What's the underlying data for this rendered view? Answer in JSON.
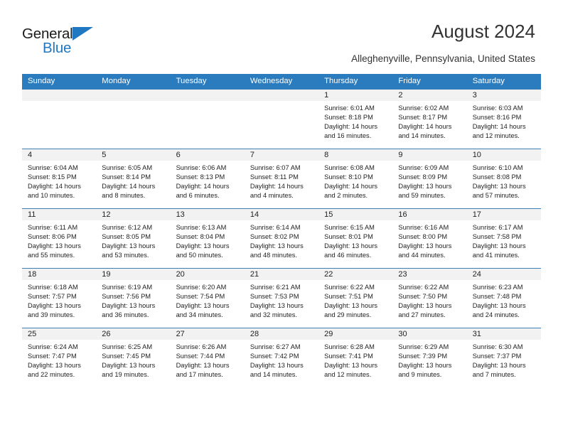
{
  "brand": {
    "name_part1": "General",
    "name_part2": "Blue",
    "triangle_icon": "triangle-icon",
    "colors": {
      "blue": "#1f78c1",
      "black": "#1b1b1b"
    }
  },
  "header": {
    "title": "August 2024",
    "subtitle": "Alleghenyville, Pennsylvania, United States"
  },
  "calendar": {
    "header_bg": "#2b7cbf",
    "weekdays": [
      "Sunday",
      "Monday",
      "Tuesday",
      "Wednesday",
      "Thursday",
      "Friday",
      "Saturday"
    ],
    "weeks": [
      [
        {
          "day": "",
          "lines": []
        },
        {
          "day": "",
          "lines": []
        },
        {
          "day": "",
          "lines": []
        },
        {
          "day": "",
          "lines": []
        },
        {
          "day": "1",
          "lines": [
            "Sunrise: 6:01 AM",
            "Sunset: 8:18 PM",
            "Daylight: 14 hours",
            "and 16 minutes."
          ]
        },
        {
          "day": "2",
          "lines": [
            "Sunrise: 6:02 AM",
            "Sunset: 8:17 PM",
            "Daylight: 14 hours",
            "and 14 minutes."
          ]
        },
        {
          "day": "3",
          "lines": [
            "Sunrise: 6:03 AM",
            "Sunset: 8:16 PM",
            "Daylight: 14 hours",
            "and 12 minutes."
          ]
        }
      ],
      [
        {
          "day": "4",
          "lines": [
            "Sunrise: 6:04 AM",
            "Sunset: 8:15 PM",
            "Daylight: 14 hours",
            "and 10 minutes."
          ]
        },
        {
          "day": "5",
          "lines": [
            "Sunrise: 6:05 AM",
            "Sunset: 8:14 PM",
            "Daylight: 14 hours",
            "and 8 minutes."
          ]
        },
        {
          "day": "6",
          "lines": [
            "Sunrise: 6:06 AM",
            "Sunset: 8:13 PM",
            "Daylight: 14 hours",
            "and 6 minutes."
          ]
        },
        {
          "day": "7",
          "lines": [
            "Sunrise: 6:07 AM",
            "Sunset: 8:11 PM",
            "Daylight: 14 hours",
            "and 4 minutes."
          ]
        },
        {
          "day": "8",
          "lines": [
            "Sunrise: 6:08 AM",
            "Sunset: 8:10 PM",
            "Daylight: 14 hours",
            "and 2 minutes."
          ]
        },
        {
          "day": "9",
          "lines": [
            "Sunrise: 6:09 AM",
            "Sunset: 8:09 PM",
            "Daylight: 13 hours",
            "and 59 minutes."
          ]
        },
        {
          "day": "10",
          "lines": [
            "Sunrise: 6:10 AM",
            "Sunset: 8:08 PM",
            "Daylight: 13 hours",
            "and 57 minutes."
          ]
        }
      ],
      [
        {
          "day": "11",
          "lines": [
            "Sunrise: 6:11 AM",
            "Sunset: 8:06 PM",
            "Daylight: 13 hours",
            "and 55 minutes."
          ]
        },
        {
          "day": "12",
          "lines": [
            "Sunrise: 6:12 AM",
            "Sunset: 8:05 PM",
            "Daylight: 13 hours",
            "and 53 minutes."
          ]
        },
        {
          "day": "13",
          "lines": [
            "Sunrise: 6:13 AM",
            "Sunset: 8:04 PM",
            "Daylight: 13 hours",
            "and 50 minutes."
          ]
        },
        {
          "day": "14",
          "lines": [
            "Sunrise: 6:14 AM",
            "Sunset: 8:02 PM",
            "Daylight: 13 hours",
            "and 48 minutes."
          ]
        },
        {
          "day": "15",
          "lines": [
            "Sunrise: 6:15 AM",
            "Sunset: 8:01 PM",
            "Daylight: 13 hours",
            "and 46 minutes."
          ]
        },
        {
          "day": "16",
          "lines": [
            "Sunrise: 6:16 AM",
            "Sunset: 8:00 PM",
            "Daylight: 13 hours",
            "and 44 minutes."
          ]
        },
        {
          "day": "17",
          "lines": [
            "Sunrise: 6:17 AM",
            "Sunset: 7:58 PM",
            "Daylight: 13 hours",
            "and 41 minutes."
          ]
        }
      ],
      [
        {
          "day": "18",
          "lines": [
            "Sunrise: 6:18 AM",
            "Sunset: 7:57 PM",
            "Daylight: 13 hours",
            "and 39 minutes."
          ]
        },
        {
          "day": "19",
          "lines": [
            "Sunrise: 6:19 AM",
            "Sunset: 7:56 PM",
            "Daylight: 13 hours",
            "and 36 minutes."
          ]
        },
        {
          "day": "20",
          "lines": [
            "Sunrise: 6:20 AM",
            "Sunset: 7:54 PM",
            "Daylight: 13 hours",
            "and 34 minutes."
          ]
        },
        {
          "day": "21",
          "lines": [
            "Sunrise: 6:21 AM",
            "Sunset: 7:53 PM",
            "Daylight: 13 hours",
            "and 32 minutes."
          ]
        },
        {
          "day": "22",
          "lines": [
            "Sunrise: 6:22 AM",
            "Sunset: 7:51 PM",
            "Daylight: 13 hours",
            "and 29 minutes."
          ]
        },
        {
          "day": "23",
          "lines": [
            "Sunrise: 6:22 AM",
            "Sunset: 7:50 PM",
            "Daylight: 13 hours",
            "and 27 minutes."
          ]
        },
        {
          "day": "24",
          "lines": [
            "Sunrise: 6:23 AM",
            "Sunset: 7:48 PM",
            "Daylight: 13 hours",
            "and 24 minutes."
          ]
        }
      ],
      [
        {
          "day": "25",
          "lines": [
            "Sunrise: 6:24 AM",
            "Sunset: 7:47 PM",
            "Daylight: 13 hours",
            "and 22 minutes."
          ]
        },
        {
          "day": "26",
          "lines": [
            "Sunrise: 6:25 AM",
            "Sunset: 7:45 PM",
            "Daylight: 13 hours",
            "and 19 minutes."
          ]
        },
        {
          "day": "27",
          "lines": [
            "Sunrise: 6:26 AM",
            "Sunset: 7:44 PM",
            "Daylight: 13 hours",
            "and 17 minutes."
          ]
        },
        {
          "day": "28",
          "lines": [
            "Sunrise: 6:27 AM",
            "Sunset: 7:42 PM",
            "Daylight: 13 hours",
            "and 14 minutes."
          ]
        },
        {
          "day": "29",
          "lines": [
            "Sunrise: 6:28 AM",
            "Sunset: 7:41 PM",
            "Daylight: 13 hours",
            "and 12 minutes."
          ]
        },
        {
          "day": "30",
          "lines": [
            "Sunrise: 6:29 AM",
            "Sunset: 7:39 PM",
            "Daylight: 13 hours",
            "and 9 minutes."
          ]
        },
        {
          "day": "31",
          "lines": [
            "Sunrise: 6:30 AM",
            "Sunset: 7:37 PM",
            "Daylight: 13 hours",
            "and 7 minutes."
          ]
        }
      ]
    ]
  }
}
